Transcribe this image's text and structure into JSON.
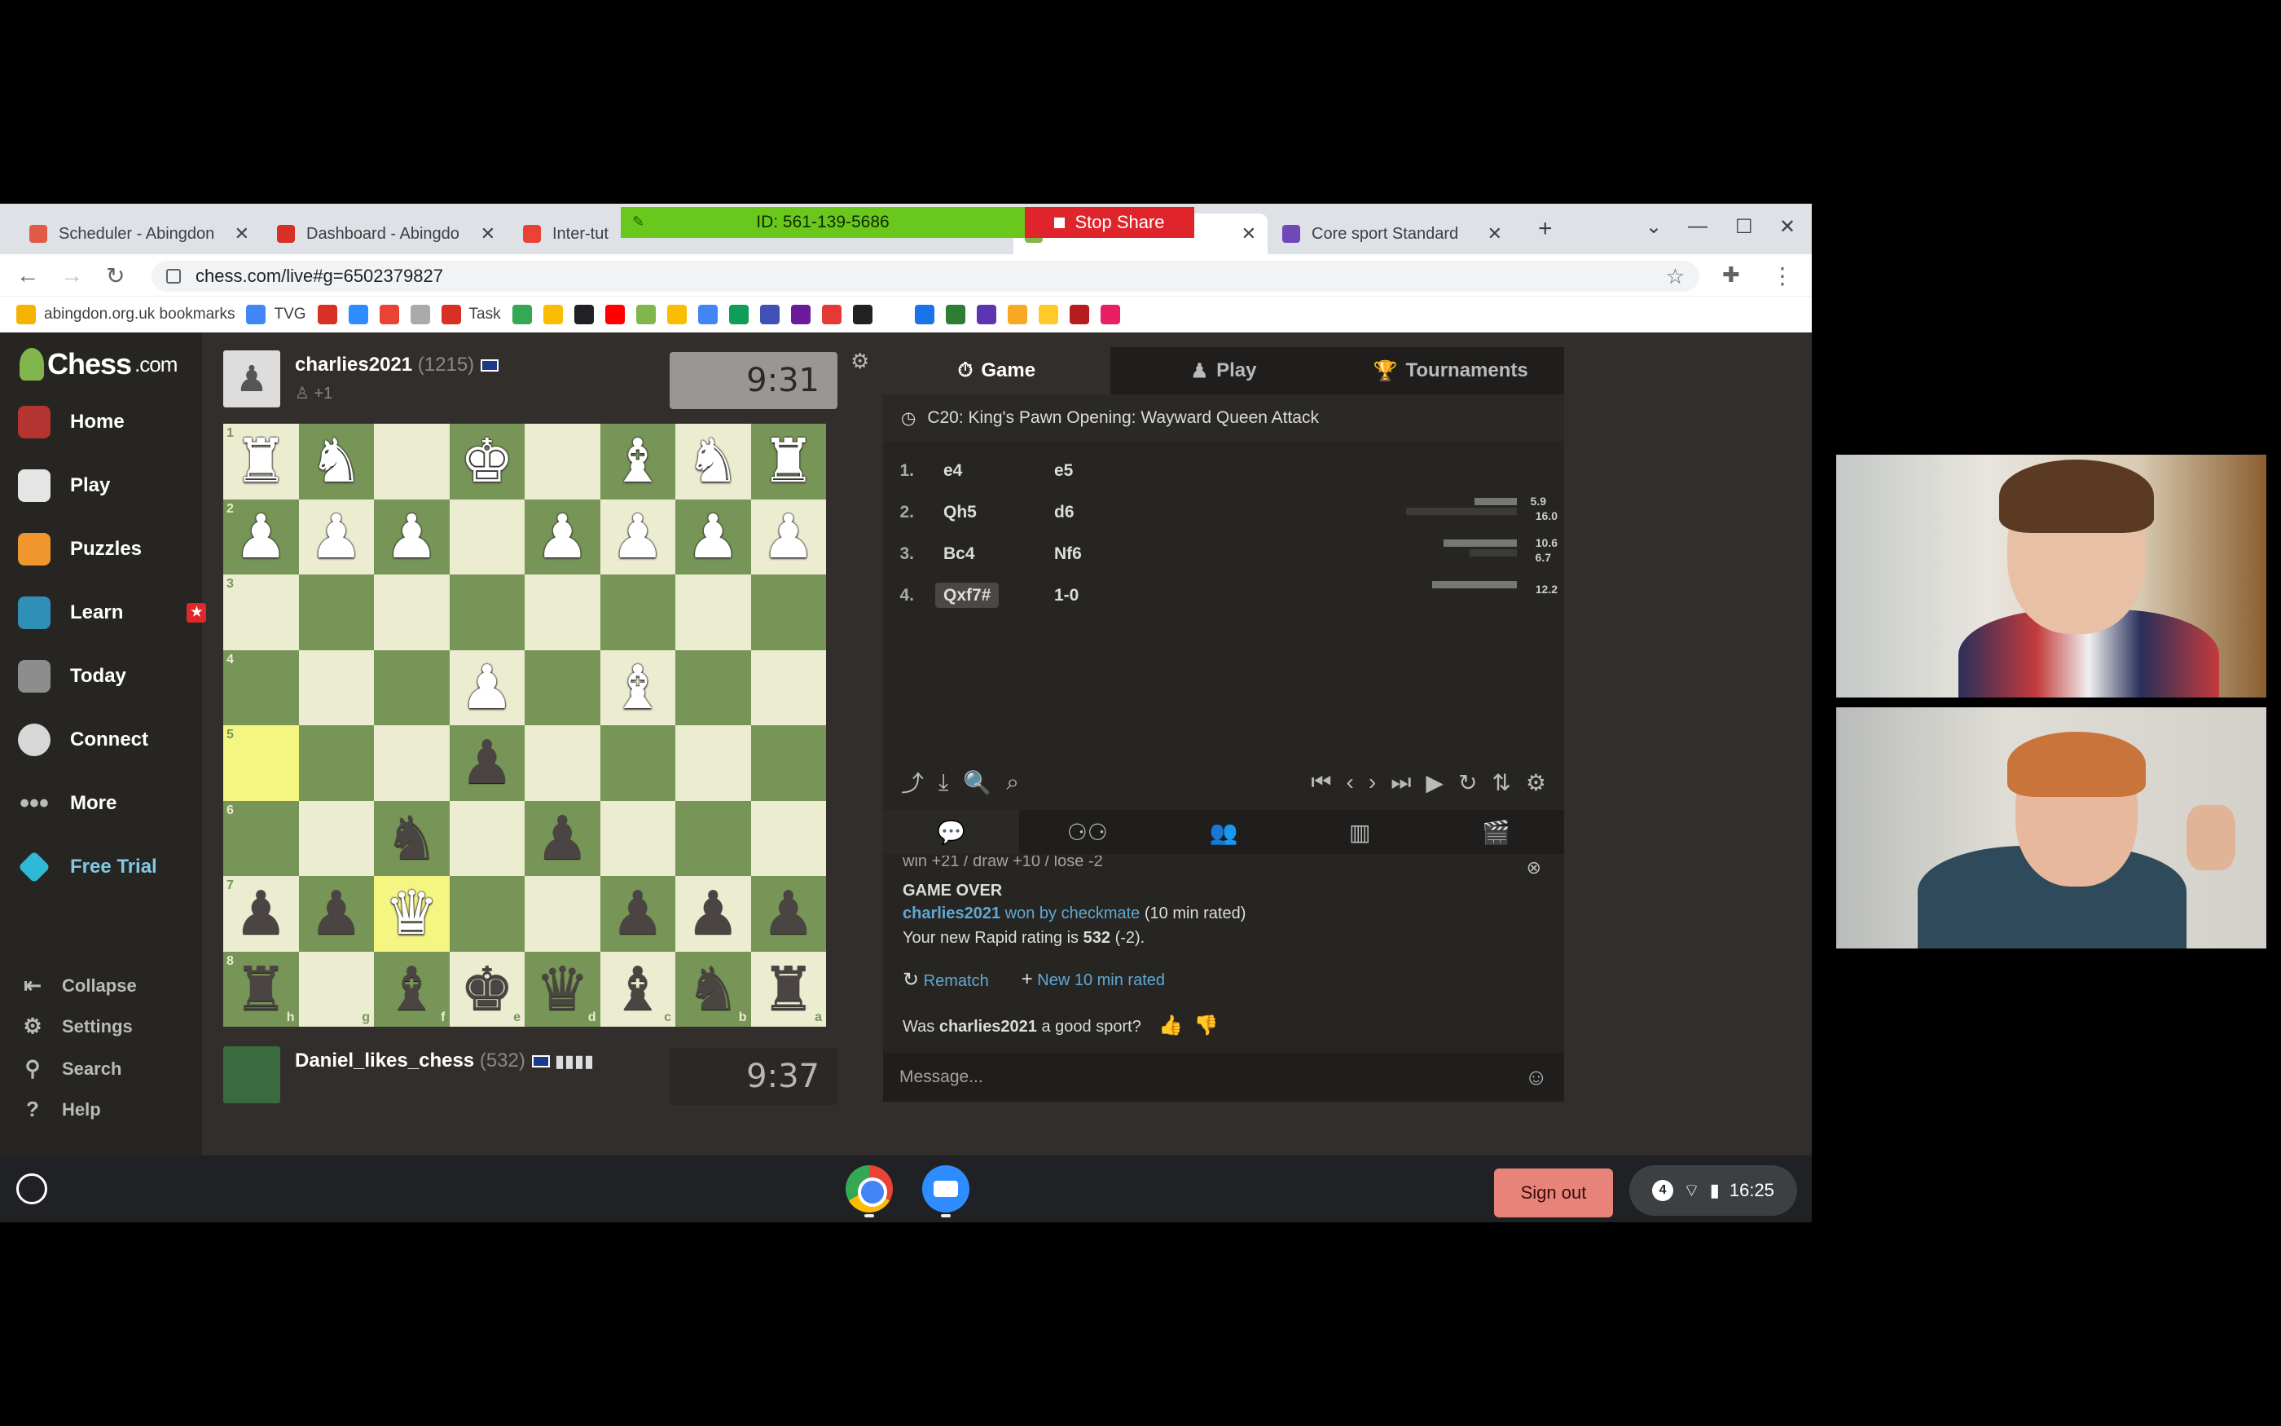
{
  "browser": {
    "tabs": [
      {
        "label": "Scheduler - Abingdon",
        "color": "#e05a47"
      },
      {
        "label": "Dashboard - Abingdo",
        "color": "#d93025"
      },
      {
        "label": "Inter-tut",
        "color": "#ea4335"
      },
      {
        "label": "Core sport Standard",
        "color": "#7248b9"
      }
    ],
    "share_id": "ID: 561-139-5686",
    "stop_share": "Stop Share",
    "url": "chess.com/live#g=6502379827",
    "bookmarks": [
      {
        "label": "abingdon.org.uk bookmarks",
        "color": "#f4b400"
      },
      {
        "label": "TVG",
        "color": "#4285f4"
      },
      {
        "label": "",
        "color": "#d93025"
      },
      {
        "label": "",
        "color": "#2d8cff"
      },
      {
        "label": "",
        "color": "#ea4335"
      },
      {
        "label": "",
        "color": "#aaaaaa"
      },
      {
        "label": "Task",
        "color": "#d93025"
      },
      {
        "label": "",
        "color": "#34a853"
      },
      {
        "label": "",
        "color": "#fbbc04"
      },
      {
        "label": "",
        "color": "#202124"
      },
      {
        "label": "",
        "color": "#ff0000"
      },
      {
        "label": "",
        "color": "#81b64c"
      },
      {
        "label": "",
        "color": "#fbbc04"
      },
      {
        "label": "",
        "color": "#4285f4"
      },
      {
        "label": "",
        "color": "#0f9d58"
      },
      {
        "label": "",
        "color": "#3f51b5"
      },
      {
        "label": "",
        "color": "#6a1b9a"
      },
      {
        "label": "",
        "color": "#e53935"
      },
      {
        "label": "",
        "color": "#212121"
      },
      {
        "label": "",
        "color": "#ffffff"
      },
      {
        "label": "",
        "color": "#1a73e8"
      },
      {
        "label": "",
        "color": "#2e7d32"
      },
      {
        "label": "",
        "color": "#5e35b1"
      },
      {
        "label": "",
        "color": "#f9a825"
      },
      {
        "label": "",
        "color": "#ffca28"
      },
      {
        "label": "",
        "color": "#b71c1c"
      },
      {
        "label": "",
        "color": "#e91e63"
      }
    ]
  },
  "sidebar": {
    "logo": "Chess",
    "logo_domain": ".com",
    "items": [
      {
        "label": "Home",
        "color": "#b33430"
      },
      {
        "label": "Play",
        "color": "#e5e5e5"
      },
      {
        "label": "Puzzles",
        "color": "#f0962e"
      },
      {
        "label": "Learn",
        "color": "#2f8fb6"
      },
      {
        "label": "Today",
        "color": "#8d8d8d"
      },
      {
        "label": "Connect",
        "color": "#d7d7d7"
      },
      {
        "label": "More",
        "color": "#272522"
      },
      {
        "label": "Free Trial",
        "color": "#2fb9d6"
      }
    ],
    "bottom": [
      {
        "label": "Collapse",
        "icon": "⇤"
      },
      {
        "label": "Settings",
        "icon": "⚙"
      },
      {
        "label": "Search",
        "icon": "⚲"
      },
      {
        "label": "Help",
        "icon": "?"
      }
    ]
  },
  "game": {
    "top_player": {
      "name": "charlies2021",
      "rating": "(1215)",
      "sub": "+1",
      "clock": "9:31"
    },
    "bottom_player": {
      "name": "Daniel_likes_chess",
      "rating": "(532)",
      "clock": "9:37"
    },
    "board": [
      [
        "♜",
        "♞",
        "",
        "♚",
        "",
        "♝",
        "♞",
        "♜"
      ],
      [
        "♟",
        "♟",
        "♟",
        "",
        "♟",
        "♟",
        "♟",
        "♟"
      ],
      [
        "",
        "",
        "",
        "",
        "",
        "",
        "",
        ""
      ],
      [
        "",
        "",
        "",
        "♟",
        "",
        "♝",
        "",
        ""
      ],
      [
        "",
        "",
        "",
        "♟",
        "",
        "",
        "",
        ""
      ],
      [
        "",
        "",
        "♞",
        "",
        "♟",
        "",
        "",
        ""
      ],
      [
        "♟",
        "♟",
        "♛",
        "",
        "",
        "♟",
        "♟",
        "♟"
      ],
      [
        "♜",
        "",
        "♝",
        "♚",
        "♛",
        "♝",
        "♞",
        "♜"
      ]
    ],
    "board_colors": [
      [
        "w",
        "w",
        "",
        "w",
        "",
        "w",
        "w",
        "w"
      ],
      [
        "w",
        "w",
        "w",
        "",
        "w",
        "w",
        "w",
        "w"
      ],
      [
        "",
        "",
        "",
        "",
        "",
        "",
        "",
        ""
      ],
      [
        "",
        "",
        "",
        "w",
        "",
        "w",
        "",
        ""
      ],
      [
        "",
        "",
        "",
        "b",
        "",
        "",
        "",
        ""
      ],
      [
        "",
        "",
        "b",
        "",
        "b",
        "",
        "",
        ""
      ],
      [
        "b",
        "b",
        "w",
        "",
        "",
        "b",
        "b",
        "b"
      ],
      [
        "b",
        "",
        "b",
        "b",
        "b",
        "b",
        "b",
        "b"
      ]
    ],
    "ranks": [
      "1",
      "2",
      "3",
      "4",
      "5",
      "6",
      "7",
      "8"
    ],
    "files": [
      "h",
      "g",
      "f",
      "e",
      "d",
      "c",
      "b",
      "a"
    ]
  },
  "panel": {
    "tabs": [
      "Game",
      "Play",
      "Tournaments"
    ],
    "opening": "C20: King's Pawn Opening: Wayward Queen Attack",
    "moves": [
      {
        "n": "1.",
        "w": "e4",
        "b": "e5"
      },
      {
        "n": "2.",
        "w": "Qh5",
        "b": "d6",
        "t1": "5.9",
        "t2": "16.0"
      },
      {
        "n": "3.",
        "w": "Bc4",
        "b": "Nf6",
        "t1": "10.6",
        "t2": "6.7"
      },
      {
        "n": "4.",
        "w": "Qxf7#",
        "b": "1-0",
        "t1": "12.2"
      }
    ],
    "chat": {
      "stats": "win +21 / draw +10 / lose -2",
      "game_over": "GAME OVER",
      "winner": "charlies2021",
      "won_by": "won by checkmate",
      "rated": "(10 min rated)",
      "new_rating_prefix": "Your new Rapid rating is",
      "new_rating": "532",
      "new_rating_delta": "(-2).",
      "rematch": "Rematch",
      "new_game": "New 10 min rated",
      "sport_prefix": "Was",
      "sport_name": "charlies2021",
      "sport_suffix": "a good sport?"
    },
    "message_placeholder": "Message..."
  },
  "taskbar": {
    "sign_out": "Sign out",
    "notifications": "4",
    "time": "16:25"
  }
}
